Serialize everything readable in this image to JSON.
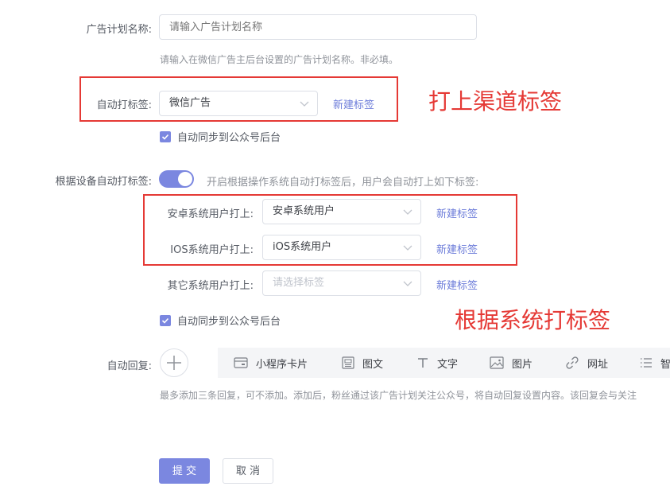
{
  "form": {
    "plan_name": {
      "label": "广告计划名称:",
      "placeholder": "请输入广告计划名称",
      "hint": "请输入在微信广告主后台设置的广告计划名称。非必填。"
    },
    "auto_tag": {
      "label": "自动打标签:",
      "value": "微信广告",
      "new_tag_link": "新建标签"
    },
    "sync_1": {
      "label": "自动同步到公众号后台"
    },
    "device_tag": {
      "label": "根据设备自动打标签:",
      "toggle_on": true,
      "description": "开启根据操作系统自动打标签后，用户会自动打上如下标签:"
    },
    "android": {
      "label": "安卓系统用户打上:",
      "value": "安卓系统用户",
      "new_tag_link": "新建标签"
    },
    "ios": {
      "label": "IOS系统用户打上:",
      "value": "iOS系统用户",
      "new_tag_link": "新建标签"
    },
    "other": {
      "label": "其它系统用户打上:",
      "placeholder": "请选择标签",
      "new_tag_link": "新建标签"
    },
    "sync_2": {
      "label": "自动同步到公众号后台"
    },
    "auto_reply": {
      "label": "自动回复:",
      "types": [
        {
          "label": "小程序卡片",
          "icon": "card-icon"
        },
        {
          "label": "图文",
          "icon": "article-icon"
        },
        {
          "label": "文字",
          "icon": "text-icon"
        },
        {
          "label": "图片",
          "icon": "image-icon"
        },
        {
          "label": "网址",
          "icon": "link-icon"
        },
        {
          "label": "智",
          "icon": "list-icon"
        }
      ],
      "hint": "最多添加三条回复，可不添加。添加后，粉丝通过该广告计划关注公众号，将自动回复设置内容。该回复会与关注"
    },
    "submit_label": "提 交",
    "cancel_label": "取 消"
  },
  "annotations": {
    "channel_tag": "打上渠道标签",
    "system_tag": "根据系统打标签"
  },
  "colors": {
    "accent": "#7b87e0",
    "link": "#6b7bd9",
    "annotation": "#e53935"
  }
}
